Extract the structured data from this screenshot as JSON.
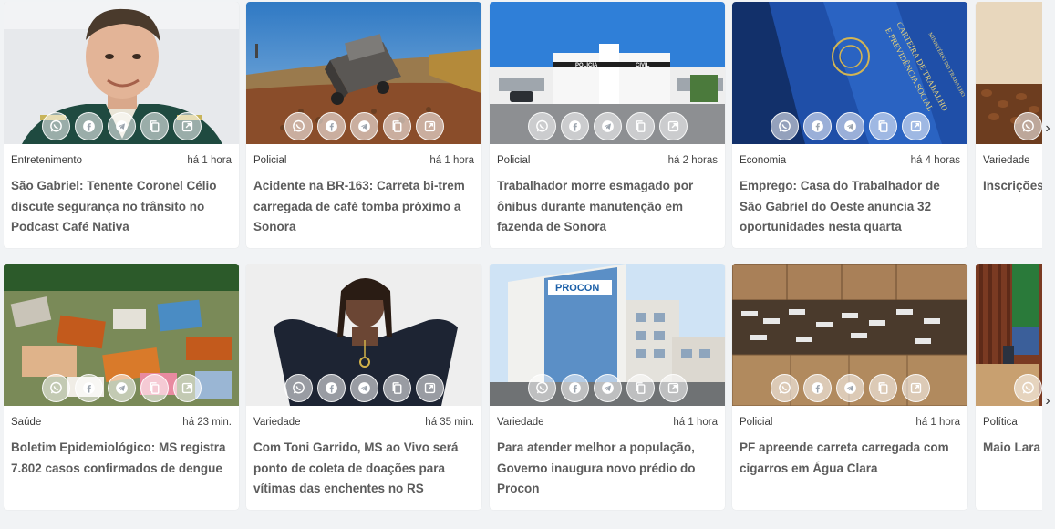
{
  "share_icons": [
    "whatsapp-icon",
    "facebook-icon",
    "telegram-icon",
    "copy-icon",
    "open-link-icon"
  ],
  "rows": [
    {
      "cards": [
        {
          "category": "Entretenimento",
          "time": "há 1 hora",
          "title": "São Gabriel: Tenente Coronel Célio discute segurança no trânsito no Podcast Café Nativa"
        },
        {
          "category": "Policial",
          "time": "há 1 hora",
          "title": "Acidente na BR-163: Carreta bi-trem carregada de café tomba próximo a Sonora"
        },
        {
          "category": "Policial",
          "time": "há 2 horas",
          "title": "Trabalhador morre esmagado por ônibus durante manutenção em fazenda de Sonora"
        },
        {
          "category": "Economia",
          "time": "há 4 horas",
          "title": "Emprego: Casa do Trabalhador de São Gabriel do Oeste anuncia 32 oportunidades nesta quarta"
        },
        {
          "category": "Variedade",
          "time": "",
          "title": "Inscrições gratuito d derivados"
        }
      ]
    },
    {
      "cards": [
        {
          "category": "Saúde",
          "time": "há 23 min.",
          "title": "Boletim Epidemiológico: MS registra 7.802 casos confirmados de dengue"
        },
        {
          "category": "Variedade",
          "time": "há 35 min.",
          "title": "Com Toni Garrido, MS ao Vivo será ponto de coleta de doações para vítimas das enchentes no RS"
        },
        {
          "category": "Variedade",
          "time": "há 1 hora",
          "title": "Para atender melhor a população, Governo inaugura novo prédio do Procon"
        },
        {
          "category": "Policial",
          "time": "há 1 hora",
          "title": "PF apreende carreta carregada com cigarros em Água Clara"
        },
        {
          "category": "Política",
          "time": "",
          "title": "Maio Lara reforçam evitar viol"
        }
      ]
    }
  ],
  "image_texts": {
    "r1c3_sign_left": "POLÍCIA",
    "r1c3_sign_right": "CIVIL",
    "r1c4_doc_line1": "CARTEIRA DE TRABALHO",
    "r1c4_doc_line2": "E PREVIDÊNCIA SOCIAL",
    "r1c4_doc_line3": "MINISTÉRIO DO TRABALHO",
    "r2c3_logo": "PROCON"
  },
  "nav": {
    "next_glyph_1": "›",
    "next_glyph_2": "›"
  }
}
